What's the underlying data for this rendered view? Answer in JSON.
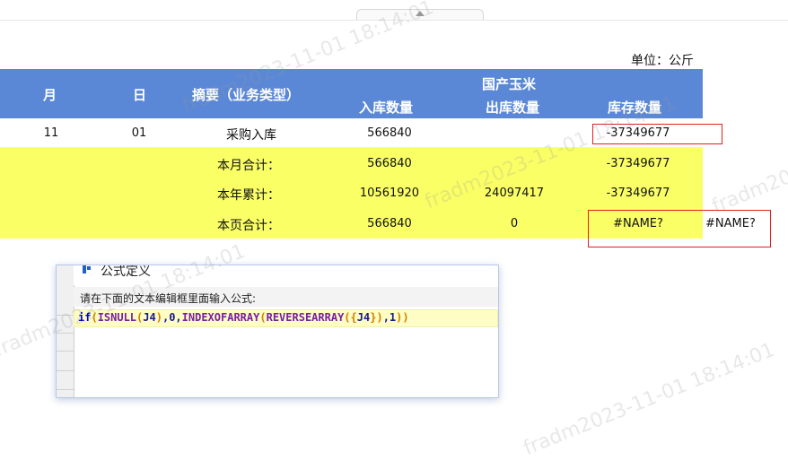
{
  "unit_label": "单位：公斤",
  "table": {
    "headers": {
      "month": "月",
      "day": "日",
      "summary": "摘要（业务类型）",
      "group": "国产玉米",
      "inbound": "入库数量",
      "outbound": "出库数量",
      "stock": "库存数量"
    },
    "rows": [
      {
        "month": "11",
        "day": "01",
        "summary": "采购入库",
        "inbound": "566840",
        "outbound": "",
        "stock": "-37349677"
      },
      {
        "month": "",
        "day": "",
        "summary": "本月合计：",
        "inbound": "566840",
        "outbound": "",
        "stock": "-37349677"
      },
      {
        "month": "",
        "day": "",
        "summary": "本年累计：",
        "inbound": "10561920",
        "outbound": "24097417",
        "stock": "-37349677"
      },
      {
        "month": "",
        "day": "",
        "summary": "本页合计：",
        "inbound": "566840",
        "outbound": "0",
        "stock": "#NAME?"
      }
    ],
    "extra_cell": "#NAME?"
  },
  "dialog": {
    "title": "公式定义",
    "prompt": "请在下面的文本编辑框里面输入公式:",
    "formula_tokens": [
      {
        "t": "if",
        "c": "kw"
      },
      {
        "t": "(",
        "c": "p"
      },
      {
        "t": "ISNULL",
        "c": "fn"
      },
      {
        "t": "(",
        "c": "p"
      },
      {
        "t": "J4",
        "c": "arg"
      },
      {
        "t": ")",
        "c": "p"
      },
      {
        "t": ",0,",
        "c": "arg"
      },
      {
        "t": "INDEXOFARRAY",
        "c": "fn"
      },
      {
        "t": "(",
        "c": "p"
      },
      {
        "t": "REVERSEARRAY",
        "c": "fn"
      },
      {
        "t": "(",
        "c": "p"
      },
      {
        "t": "{",
        "c": "p"
      },
      {
        "t": "J4",
        "c": "arg"
      },
      {
        "t": "}",
        "c": "p"
      },
      {
        "t": ")",
        "c": "p"
      },
      {
        "t": ",1",
        "c": "arg"
      },
      {
        "t": ")",
        "c": "p"
      },
      {
        "t": ")",
        "c": "p"
      }
    ]
  },
  "watermark": "fradm2023-11-01 18:14:01",
  "colors": {
    "header_bg": "#5b88d6",
    "highlight_row": "#faff66",
    "error_outline": "#e02020"
  }
}
